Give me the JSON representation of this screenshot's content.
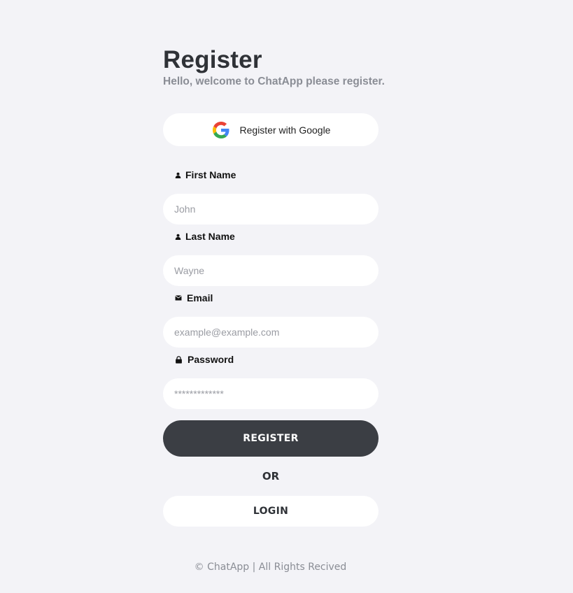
{
  "header": {
    "title": "Register",
    "subtitle": "Hello, welcome to ChatApp please register."
  },
  "google_button": {
    "label": "Register with Google",
    "icon": "google-icon"
  },
  "fields": {
    "first_name": {
      "label": "First Name",
      "placeholder": "John",
      "icon": "user-icon"
    },
    "last_name": {
      "label": "Last Name",
      "placeholder": "Wayne",
      "icon": "user-icon"
    },
    "email": {
      "label": "Email",
      "placeholder": "example@example.com",
      "icon": "envelope-icon"
    },
    "password": {
      "label": "Password",
      "placeholder": "*************",
      "icon": "lock-icon"
    }
  },
  "actions": {
    "register_label": "REGISTER",
    "or_label": "OR",
    "login_label": "LOGIN"
  },
  "footer": {
    "text": "© ChatApp | All Rights Recived"
  },
  "colors": {
    "background": "#f3f3f7",
    "primary_button": "#3b3e44",
    "input_background": "#ffffff",
    "subtitle": "#8a8d95"
  }
}
